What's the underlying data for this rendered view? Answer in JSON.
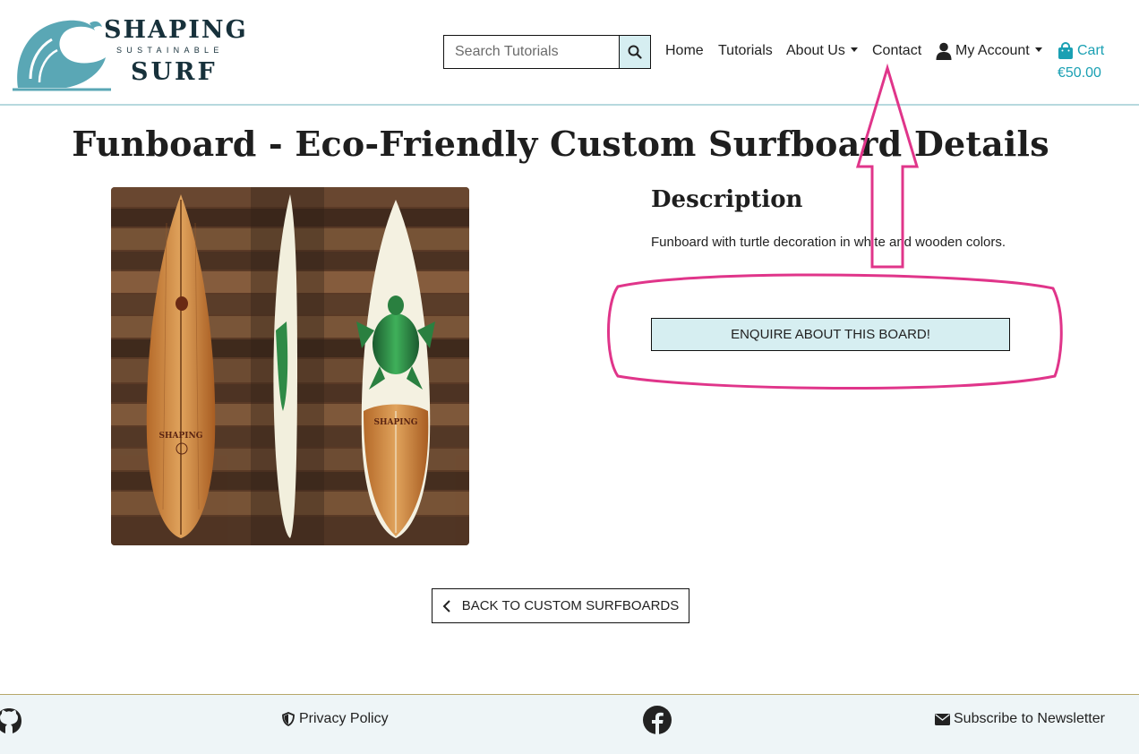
{
  "header": {
    "logo": {
      "line1": "SHAPING",
      "line2": "SUSTAINABLE",
      "line3": "SURF"
    },
    "search": {
      "placeholder": "Search Tutorials"
    },
    "nav": {
      "home": "Home",
      "tutorials": "Tutorials",
      "about": "About Us",
      "contact": "Contact",
      "account": "My Account",
      "cart": "Cart",
      "cart_total": "€50.00"
    }
  },
  "main": {
    "title": "Funboard - Eco-Friendly Custom Surfboard Details",
    "description_heading": "Description",
    "description_text": "Funboard with turtle decoration in white and wooden colors.",
    "enquire_button": "ENQUIRE ABOUT THIS BOARD!",
    "back_button": "BACK TO CUSTOM SURFBOARDS",
    "image": {
      "board_brand_1": "SHAPING",
      "board_brand_2": "SHAPING"
    }
  },
  "footer": {
    "privacy": "Privacy Policy",
    "newsletter": "Subscribe to Newsletter"
  },
  "colors": {
    "accent": "#1aa0b3",
    "button_bg": "#d6eef1",
    "annotation": "#e0358a",
    "logo_text": "#17313b",
    "logo_wave": "#5aa7b5"
  }
}
